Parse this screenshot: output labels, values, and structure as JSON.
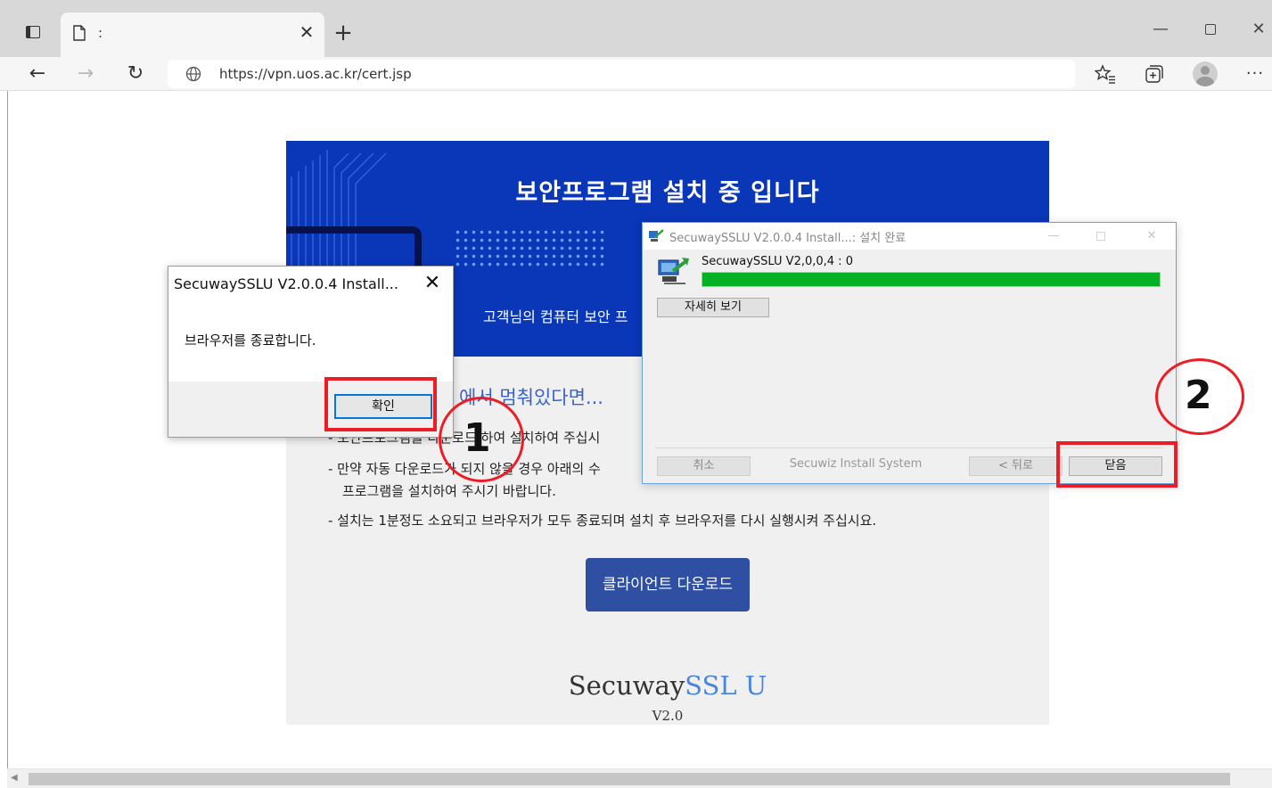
{
  "browser": {
    "tab_title": ":",
    "url": "https://vpn.uos.ac.kr/cert.jsp",
    "icons": {
      "tab_actions": "vertical-tabs-icon",
      "page": "page-icon",
      "close": "close-icon",
      "new_tab": "plus-icon",
      "back": "arrow-left-icon",
      "forward": "arrow-right-icon",
      "refresh": "refresh-icon",
      "site_info": "globe-icon",
      "favorites": "favorites-icon",
      "collections": "collections-icon",
      "profile": "profile-icon",
      "more": "more-icon"
    }
  },
  "page": {
    "banner_title": "보안프로그램 설치 중 입니다",
    "banner_subtitle": "고객님의 컴퓨터 보안 프",
    "stopped_heading": "에서 멈춰있다면...",
    "instructions": [
      "- 보안프로그램을 다운로드 하여 설치하여 주십시",
      "- 만약 자동 다운로드가 되지 않을 경우 아래의 수",
      "프로그램을 설치하여 주시기 바랍니다.",
      "- 설치는 1분정도 소요되고 브라우저가 모두 종료되며 설치 후 브라우저를 다시 실행시켜 주십시요."
    ],
    "download_button": "클라이언트 다운로드",
    "brand_main": "Secuway",
    "brand_accent": "SSL U",
    "brand_version": "V2.0",
    "colors": {
      "banner": "#0a36b8",
      "button": "#2e4fa2",
      "accent": "#4a86dc"
    }
  },
  "msgbox": {
    "title": "SecuwaySSLU V2.0.0.4 Install...",
    "message": "브라우저를 종료합니다.",
    "ok_label": "확인"
  },
  "installer": {
    "title": "SecuwaySSLU V2.0.0.4 Install...: 설치 완료",
    "status": "SecuwaySSLU V2,0,0,4 : 0",
    "progress_percent": 100,
    "details_label": "자세히 보기",
    "cancel_label": "취소",
    "brand_text": "Secuwiz Install System",
    "back_label": "< 뒤로",
    "close_label": "닫음",
    "colors": {
      "progress": "#06b025"
    }
  },
  "annotations": {
    "step1": "1",
    "step2": "2",
    "color": "#ee1c24"
  }
}
